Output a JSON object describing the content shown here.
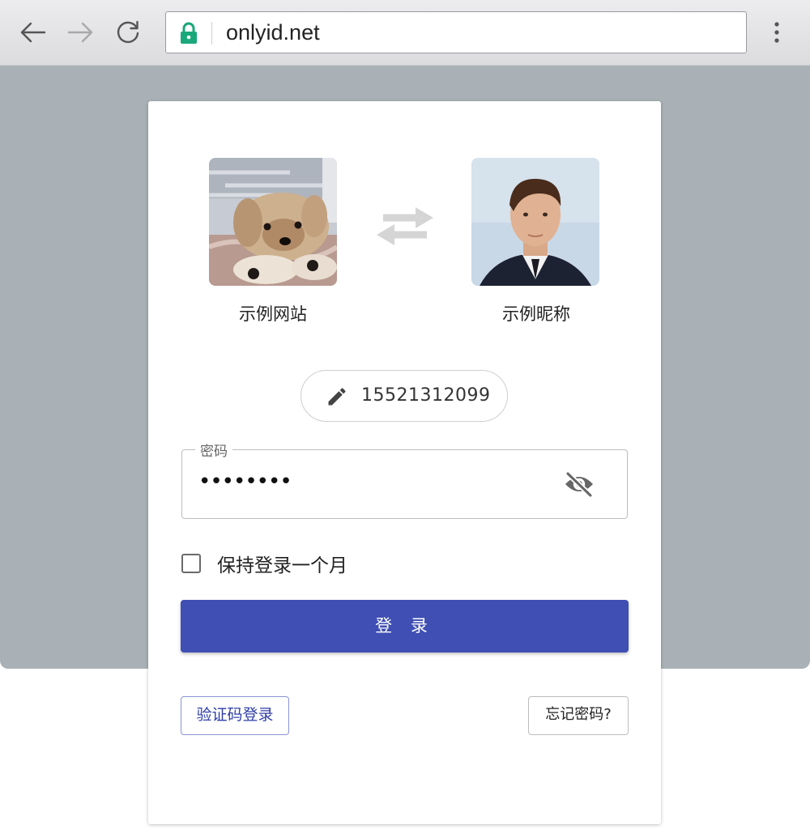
{
  "browser": {
    "url": "onlyid.net",
    "icons": [
      "back-arrow-icon",
      "forward-arrow-icon",
      "reload-icon",
      "lock-icon",
      "more-vert-icon"
    ]
  },
  "login": {
    "site_label": "示例网站",
    "user_label": "示例昵称",
    "phone": "15521312099",
    "password_label": "密码",
    "password_value": "••••••••",
    "remember_label": "保持登录一个月",
    "login_button": "登 录",
    "sms_login_button": "验证码登录",
    "forgot_button": "忘记密码?"
  },
  "colors": {
    "primary": "#3f4fb3",
    "lock": "#1aa87a",
    "page_background": "#a9b1b6"
  }
}
